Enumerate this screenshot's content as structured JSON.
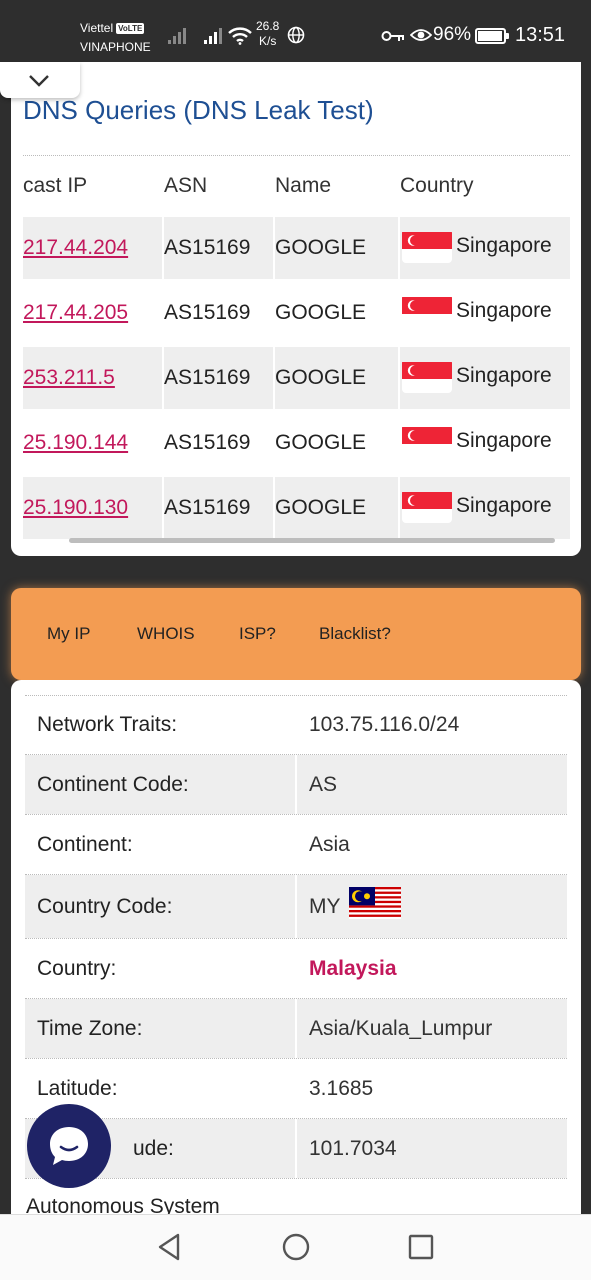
{
  "status_bar": {
    "carrier1": "Viettel",
    "volte_badge": "VoLTE",
    "carrier2": "VINAPHONE",
    "net_speed_value": "26.8",
    "net_speed_unit": "K/s",
    "battery_percent": "96%",
    "battery_level": 0.96,
    "time": "13:51",
    "icons": [
      "signal-icon",
      "signal-icon",
      "wifi-icon",
      "globe-icon",
      "key-icon",
      "eye-icon",
      "battery-icon"
    ]
  },
  "dns_card": {
    "title": "DNS Queries (DNS Leak Test)",
    "columns": [
      "cast IP",
      "ASN",
      "Name",
      "Country"
    ],
    "rows": [
      {
        "ip": "217.44.204",
        "asn": "AS15169",
        "name": "GOOGLE",
        "country": "Singapore"
      },
      {
        "ip": "217.44.205",
        "asn": "AS15169",
        "name": "GOOGLE",
        "country": "Singapore"
      },
      {
        "ip": "253.211.5",
        "asn": "AS15169",
        "name": "GOOGLE",
        "country": "Singapore"
      },
      {
        "ip": "25.190.144",
        "asn": "AS15169",
        "name": "GOOGLE",
        "country": "Singapore"
      },
      {
        "ip": "25.190.130",
        "asn": "AS15169",
        "name": "GOOGLE",
        "country": "Singapore"
      }
    ]
  },
  "menu": {
    "items": [
      "My IP",
      "WHOIS",
      "ISP?",
      "Blacklist?"
    ]
  },
  "info": {
    "rows": [
      {
        "label": "Network Traits:",
        "value": "103.75.116.0/24"
      },
      {
        "label": "Continent Code:",
        "value": "AS"
      },
      {
        "label": "Continent:",
        "value": "Asia"
      },
      {
        "label": "Country Code:",
        "value": "MY"
      },
      {
        "label": "Country:",
        "value": "Malaysia"
      },
      {
        "label": "Time Zone:",
        "value": "Asia/Kuala_Lumpur"
      },
      {
        "label": "Latitude:",
        "value": "3.1685"
      },
      {
        "label": "ude:",
        "value": "101.7034"
      }
    ],
    "partial_label": "Autonomous System"
  },
  "colors": {
    "title": "#1e4f93",
    "link": "#c2185b",
    "menu_bg": "#f39c52",
    "chat_bg": "#1f2366"
  }
}
